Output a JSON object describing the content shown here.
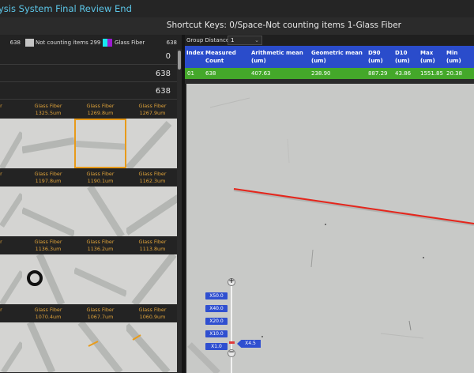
{
  "window": {
    "title": "ysis System Final Review End"
  },
  "shortcut": {
    "text": "Shortcut Keys: 0/Space-Not counting items 1-Glass Fiber"
  },
  "legend": {
    "total": "638",
    "not_counting_label": "Not counting items",
    "not_counting_count": "299",
    "glass_fiber_label": "Glass Fiber",
    "glass_fiber_count": "638",
    "color_not_counting": "#c4c4c4",
    "color_glass_fiber_a": "#17e8f0",
    "color_glass_fiber_b": "#9b1bd0"
  },
  "stats": [
    "0",
    "638",
    "638"
  ],
  "thumbnails": [
    {
      "label": "Glass Fiber",
      "length": "1325.5um"
    },
    {
      "label": "Glass Fiber",
      "length": "1269.8um"
    },
    {
      "label": "Glass Fiber",
      "length": "1267.9um"
    },
    {
      "label": "Glass Fiber",
      "length": "1197.8um"
    },
    {
      "label": "Glass Fiber",
      "length": "1190.1um"
    },
    {
      "label": "Glass Fiber",
      "length": "1162.3um"
    },
    {
      "label": "Glass Fiber",
      "length": "1136.3um"
    },
    {
      "label": "Glass Fiber",
      "length": "1136.2um"
    },
    {
      "label": "Glass Fiber",
      "length": "1113.8um"
    },
    {
      "label": "Glass Fiber",
      "length": "1070.4um"
    },
    {
      "label": "Glass Fiber",
      "length": "1067.7um"
    },
    {
      "label": "Glass Fiber",
      "length": "1060.9um"
    }
  ],
  "thumbnail_partial_label": "Fiber",
  "group": {
    "label": "Group Distance:",
    "value": "1"
  },
  "table": {
    "headers": [
      "Index",
      "Measured Count",
      "Arithmetic mean (um)",
      "Geometric mean (um)",
      "D90 (um)",
      "D10 (um)",
      "Max (um)",
      "Min (um)"
    ],
    "row": [
      "01",
      "638",
      "407.63",
      "238.90",
      "887.29",
      "43.86",
      "1551.85",
      "20.38"
    ]
  },
  "zoom": {
    "levels": [
      "X50.0",
      "X40.0",
      "X20.0",
      "X10.0",
      "X1.0"
    ],
    "current": "X4.5",
    "plus": "+",
    "minus": "−"
  }
}
